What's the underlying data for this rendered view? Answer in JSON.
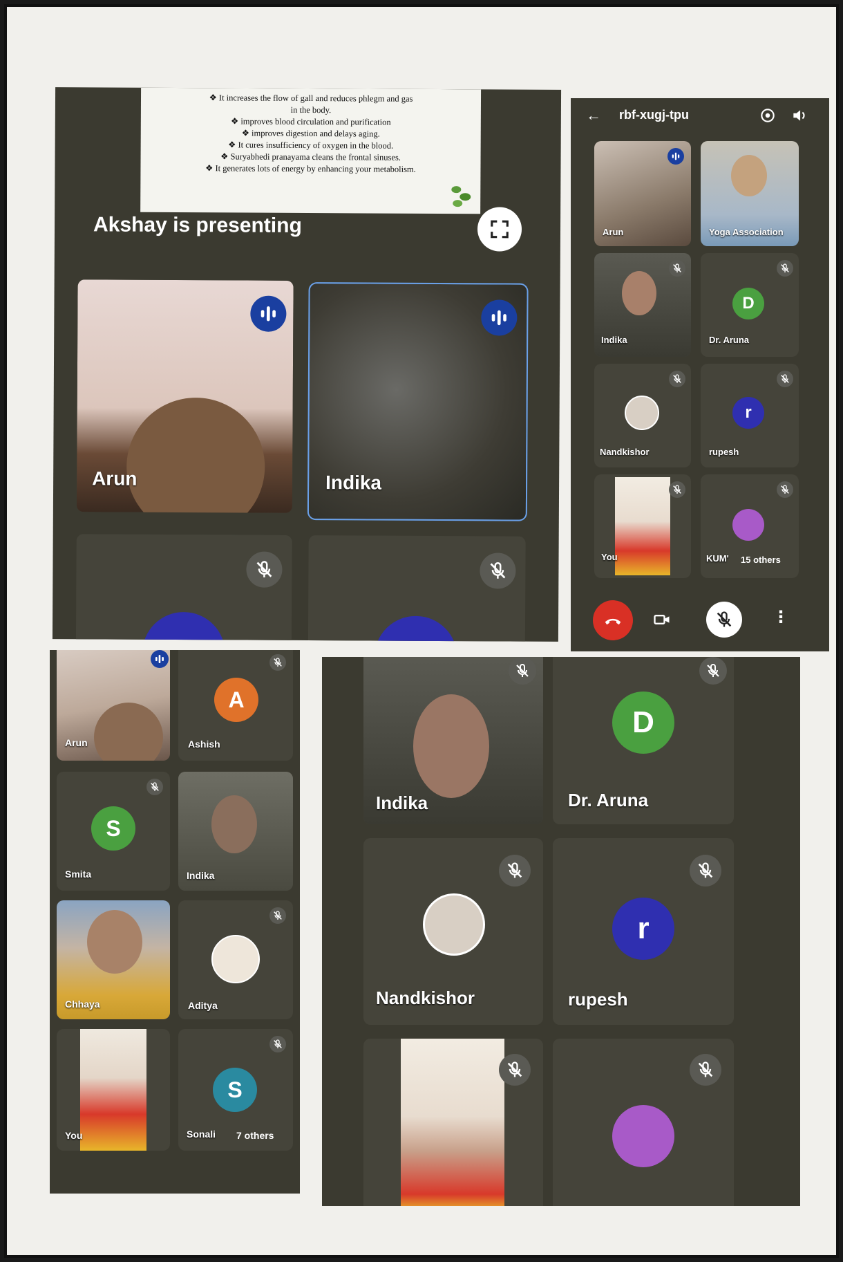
{
  "colors": {
    "meet_bg": "#3b3a30",
    "tile_bg": "#45443a",
    "active_border": "#6aa0e8",
    "end_call": "#d93025",
    "talk_badge": "#1a3fa0",
    "avatar_green": "#4aa040",
    "avatar_orange": "#e0722a",
    "avatar_indigo": "#2f2fb0",
    "avatar_teal": "#2a8aa0"
  },
  "icons": [
    "speaking-icon",
    "mic-off-icon",
    "fullscreen-icon",
    "back-arrow-icon",
    "switch-camera-icon",
    "speaker-icon",
    "end-call-icon",
    "camera-icon",
    "more-vert-icon"
  ],
  "shot1": {
    "slide_lines": [
      "❖ It increases the flow of gall and reduces phlegm and gas",
      "in the body.",
      "❖ improves blood circulation and purification",
      "❖ improves digestion and delays aging.",
      "❖ It cures insufficiency of oxygen in the blood.",
      "❖ Suryabhedi pranayama cleans the frontal sinuses.",
      "❖ It generates lots of energy by enhancing your metabolism."
    ],
    "presenting": "Akshay is presenting",
    "tiles": {
      "arun": "Arun",
      "indika": "Indika"
    }
  },
  "shot2": {
    "meeting_code": "rbf-xugj-tpu",
    "tiles": {
      "arun": "Arun",
      "yoga": "Yoga Association",
      "indika": "Indika",
      "aruna": "Dr. Aruna",
      "aruna_initial": "D",
      "nandkishor": "Nandkishor",
      "rupesh": "rupesh",
      "rupesh_initial": "r",
      "you": "You",
      "kum": "KUM'",
      "others": "15 others"
    }
  },
  "shot3": {
    "tiles": {
      "arun": "Arun",
      "ashish": "Ashish",
      "ashish_initial": "A",
      "smita": "Smita",
      "smita_initial": "S",
      "indika": "Indika",
      "chhaya": "Chhaya",
      "aditya": "Aditya",
      "you": "You",
      "sonali": "Sonali",
      "sonali_initial": "S",
      "others": "7 others"
    }
  },
  "shot4": {
    "tiles": {
      "indika": "Indika",
      "aruna": "Dr. Aruna",
      "aruna_initial": "D",
      "nandkishor": "Nandkishor",
      "rupesh": "rupesh",
      "rupesh_initial": "r"
    }
  }
}
